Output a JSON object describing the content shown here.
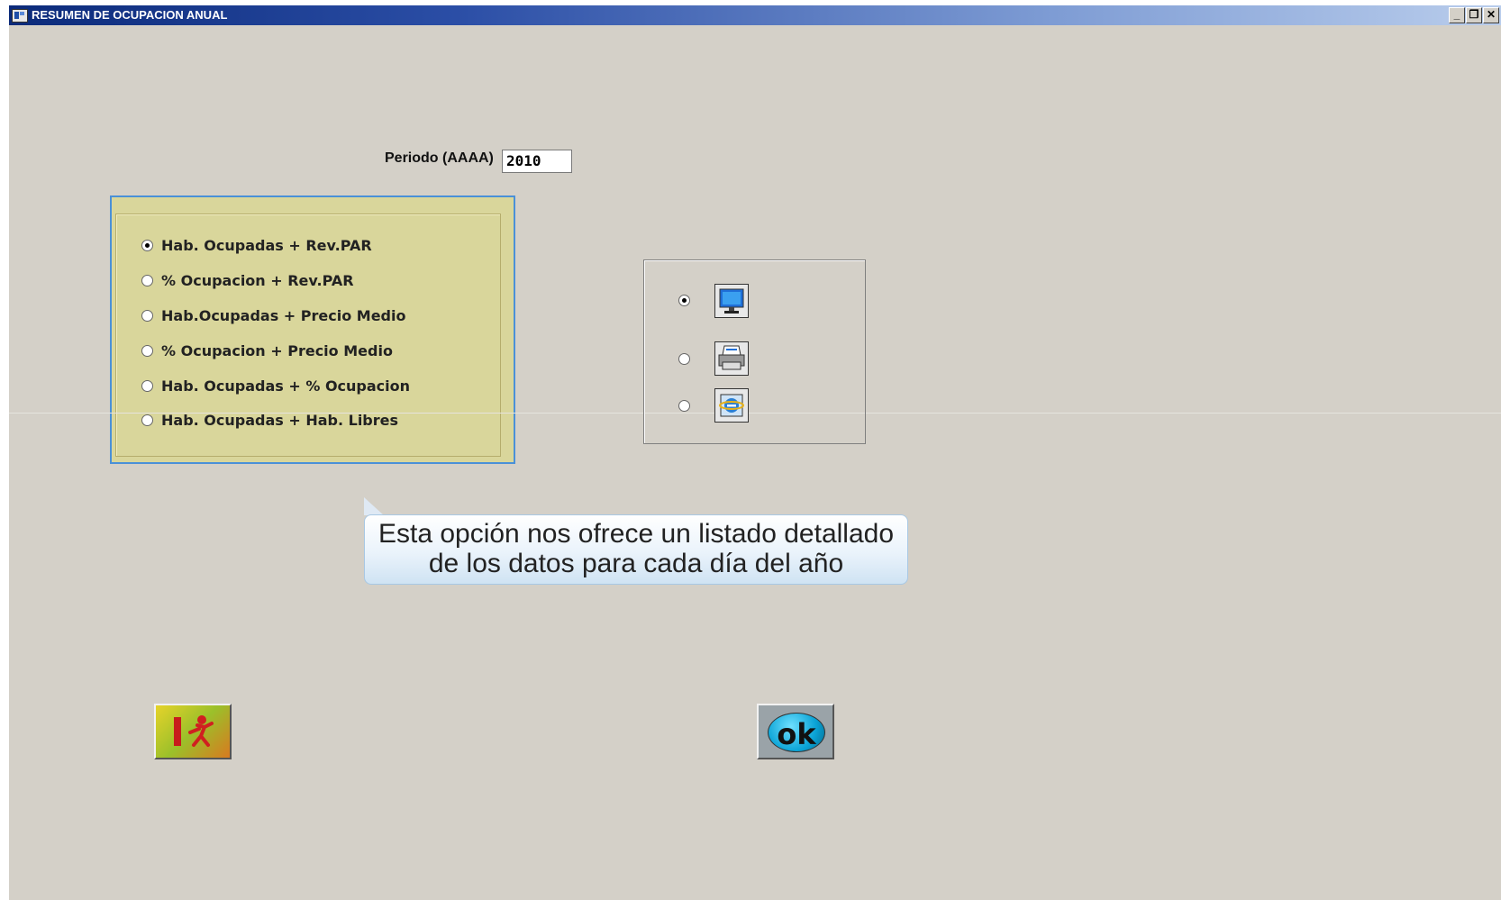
{
  "window": {
    "title": "RESUMEN DE OCUPACION ANUAL"
  },
  "caption_buttons": {
    "minimize": "_",
    "restore": "❐",
    "close": "✕"
  },
  "period": {
    "label": "Periodo (AAAA)",
    "value": "2010"
  },
  "report_options": {
    "selected_index": 0,
    "items": [
      {
        "label": "Hab. Ocupadas + Rev.PAR",
        "checked": true
      },
      {
        "label": "% Ocupacion + Rev.PAR",
        "checked": false
      },
      {
        "label": "Hab.Ocupadas + Precio Medio",
        "checked": false
      },
      {
        "label": "% Ocupacion + Precio Medio",
        "checked": false
      },
      {
        "label": "Hab. Ocupadas + % Ocupacion",
        "checked": false
      },
      {
        "label": "Hab. Ocupadas + Hab. Libres",
        "checked": false
      }
    ]
  },
  "output_options": {
    "items": [
      {
        "icon": "monitor-icon",
        "checked": true
      },
      {
        "icon": "printer-icon",
        "checked": false
      },
      {
        "icon": "internet-explorer-icon",
        "checked": false
      }
    ]
  },
  "tooltip": {
    "text": "Esta opción nos ofrece un listado detallado de los datos para cada día del año"
  },
  "buttons": {
    "exit_icon": "exit-door-icon",
    "ok_label": "ok"
  }
}
